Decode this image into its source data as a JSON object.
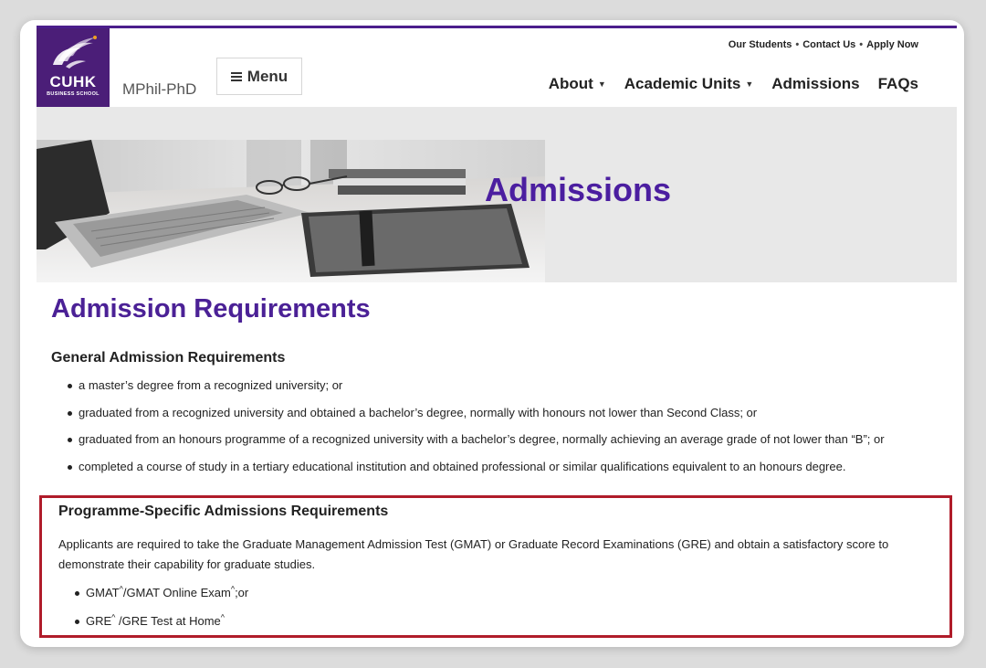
{
  "header": {
    "logo_main": "CUHK",
    "logo_sub": "BUSINESS SCHOOL",
    "site_name": "MPhil-PhD",
    "menu_label": "Menu",
    "utility_links": [
      "Our Students",
      "Contact Us",
      "Apply Now"
    ],
    "nav": [
      {
        "label": "About",
        "dropdown": true
      },
      {
        "label": "Academic Units",
        "dropdown": true
      },
      {
        "label": "Admissions",
        "dropdown": false
      },
      {
        "label": "FAQs",
        "dropdown": false
      }
    ]
  },
  "banner": {
    "title": "Admissions"
  },
  "content": {
    "heading": "Admission Requirements",
    "general": {
      "title": "General Admission Requirements",
      "items": [
        "a master’s degree from a recognized university; or",
        "graduated from a recognized university and obtained a bachelor’s degree, normally with honours not lower than Second Class; or",
        "graduated from an honours programme of a recognized university with a bachelor’s degree, normally achieving an average grade of not lower than “B”; or",
        "completed a course of study in a tertiary educational institution and obtained professional or similar qualifications equivalent to an honours degree."
      ]
    },
    "programme": {
      "title": "Programme-Specific Admissions Requirements",
      "description": "Applicants are required to take the Graduate Management Admission Test (GMAT) or Graduate Record Examinations (GRE) and obtain a satisfactory score to demonstrate their capability for graduate studies.",
      "items": [
        {
          "a": "GMAT",
          "b": "/GMAT Online Exam",
          "c": ";or"
        },
        {
          "a": "GRE",
          "b": " /GRE Test at Home",
          "c": ""
        }
      ],
      "caret_mark": "^"
    }
  },
  "colors": {
    "brand_purple": "#4b1e78",
    "heading_purple": "#4b2196",
    "highlight_red": "#b01c2a"
  }
}
